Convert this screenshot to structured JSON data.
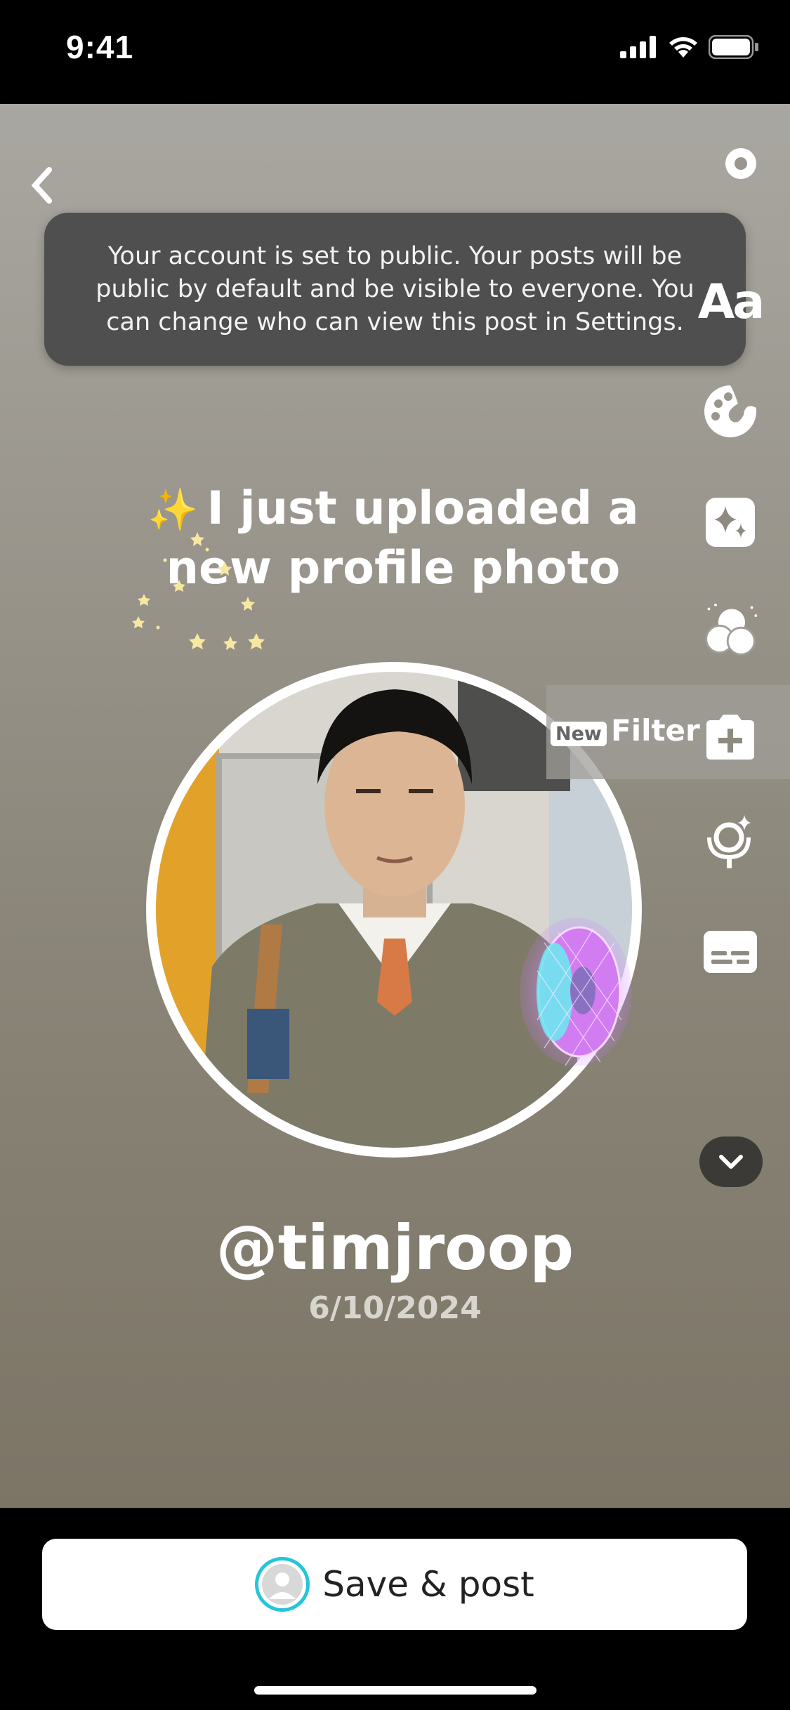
{
  "status_bar": {
    "time": "9:41"
  },
  "tooltip": {
    "text": "Your account is set to public. Your posts will be public by default and be visible to everyone. You can change who can view this post in Settings."
  },
  "headline": {
    "emoji": "✨",
    "text": "I just uploaded a new profile photo"
  },
  "profile": {
    "username": "@timjroop",
    "date": "6/10/2024"
  },
  "toolbar": {
    "text_tool": "Aa",
    "filter": {
      "badge": "New",
      "label": "Filter"
    }
  },
  "footer": {
    "save_label": "Save & post"
  },
  "colors": {
    "accent_ring": "#27c4d9",
    "tooltip_bg": "#4f4f4f"
  }
}
